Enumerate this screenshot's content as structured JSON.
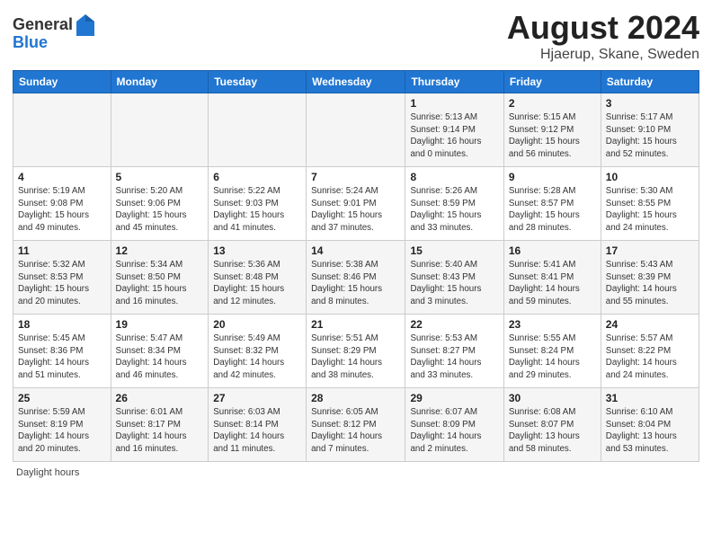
{
  "header": {
    "logo_general": "General",
    "logo_blue": "Blue",
    "main_title": "August 2024",
    "subtitle": "Hjaerup, Skane, Sweden"
  },
  "weekdays": [
    "Sunday",
    "Monday",
    "Tuesday",
    "Wednesday",
    "Thursday",
    "Friday",
    "Saturday"
  ],
  "footer": "Daylight hours",
  "weeks": [
    [
      {
        "day": "",
        "info": ""
      },
      {
        "day": "",
        "info": ""
      },
      {
        "day": "",
        "info": ""
      },
      {
        "day": "",
        "info": ""
      },
      {
        "day": "1",
        "info": "Sunrise: 5:13 AM\nSunset: 9:14 PM\nDaylight: 16 hours\nand 0 minutes."
      },
      {
        "day": "2",
        "info": "Sunrise: 5:15 AM\nSunset: 9:12 PM\nDaylight: 15 hours\nand 56 minutes."
      },
      {
        "day": "3",
        "info": "Sunrise: 5:17 AM\nSunset: 9:10 PM\nDaylight: 15 hours\nand 52 minutes."
      }
    ],
    [
      {
        "day": "4",
        "info": "Sunrise: 5:19 AM\nSunset: 9:08 PM\nDaylight: 15 hours\nand 49 minutes."
      },
      {
        "day": "5",
        "info": "Sunrise: 5:20 AM\nSunset: 9:06 PM\nDaylight: 15 hours\nand 45 minutes."
      },
      {
        "day": "6",
        "info": "Sunrise: 5:22 AM\nSunset: 9:03 PM\nDaylight: 15 hours\nand 41 minutes."
      },
      {
        "day": "7",
        "info": "Sunrise: 5:24 AM\nSunset: 9:01 PM\nDaylight: 15 hours\nand 37 minutes."
      },
      {
        "day": "8",
        "info": "Sunrise: 5:26 AM\nSunset: 8:59 PM\nDaylight: 15 hours\nand 33 minutes."
      },
      {
        "day": "9",
        "info": "Sunrise: 5:28 AM\nSunset: 8:57 PM\nDaylight: 15 hours\nand 28 minutes."
      },
      {
        "day": "10",
        "info": "Sunrise: 5:30 AM\nSunset: 8:55 PM\nDaylight: 15 hours\nand 24 minutes."
      }
    ],
    [
      {
        "day": "11",
        "info": "Sunrise: 5:32 AM\nSunset: 8:53 PM\nDaylight: 15 hours\nand 20 minutes."
      },
      {
        "day": "12",
        "info": "Sunrise: 5:34 AM\nSunset: 8:50 PM\nDaylight: 15 hours\nand 16 minutes."
      },
      {
        "day": "13",
        "info": "Sunrise: 5:36 AM\nSunset: 8:48 PM\nDaylight: 15 hours\nand 12 minutes."
      },
      {
        "day": "14",
        "info": "Sunrise: 5:38 AM\nSunset: 8:46 PM\nDaylight: 15 hours\nand 8 minutes."
      },
      {
        "day": "15",
        "info": "Sunrise: 5:40 AM\nSunset: 8:43 PM\nDaylight: 15 hours\nand 3 minutes."
      },
      {
        "day": "16",
        "info": "Sunrise: 5:41 AM\nSunset: 8:41 PM\nDaylight: 14 hours\nand 59 minutes."
      },
      {
        "day": "17",
        "info": "Sunrise: 5:43 AM\nSunset: 8:39 PM\nDaylight: 14 hours\nand 55 minutes."
      }
    ],
    [
      {
        "day": "18",
        "info": "Sunrise: 5:45 AM\nSunset: 8:36 PM\nDaylight: 14 hours\nand 51 minutes."
      },
      {
        "day": "19",
        "info": "Sunrise: 5:47 AM\nSunset: 8:34 PM\nDaylight: 14 hours\nand 46 minutes."
      },
      {
        "day": "20",
        "info": "Sunrise: 5:49 AM\nSunset: 8:32 PM\nDaylight: 14 hours\nand 42 minutes."
      },
      {
        "day": "21",
        "info": "Sunrise: 5:51 AM\nSunset: 8:29 PM\nDaylight: 14 hours\nand 38 minutes."
      },
      {
        "day": "22",
        "info": "Sunrise: 5:53 AM\nSunset: 8:27 PM\nDaylight: 14 hours\nand 33 minutes."
      },
      {
        "day": "23",
        "info": "Sunrise: 5:55 AM\nSunset: 8:24 PM\nDaylight: 14 hours\nand 29 minutes."
      },
      {
        "day": "24",
        "info": "Sunrise: 5:57 AM\nSunset: 8:22 PM\nDaylight: 14 hours\nand 24 minutes."
      }
    ],
    [
      {
        "day": "25",
        "info": "Sunrise: 5:59 AM\nSunset: 8:19 PM\nDaylight: 14 hours\nand 20 minutes."
      },
      {
        "day": "26",
        "info": "Sunrise: 6:01 AM\nSunset: 8:17 PM\nDaylight: 14 hours\nand 16 minutes."
      },
      {
        "day": "27",
        "info": "Sunrise: 6:03 AM\nSunset: 8:14 PM\nDaylight: 14 hours\nand 11 minutes."
      },
      {
        "day": "28",
        "info": "Sunrise: 6:05 AM\nSunset: 8:12 PM\nDaylight: 14 hours\nand 7 minutes."
      },
      {
        "day": "29",
        "info": "Sunrise: 6:07 AM\nSunset: 8:09 PM\nDaylight: 14 hours\nand 2 minutes."
      },
      {
        "day": "30",
        "info": "Sunrise: 6:08 AM\nSunset: 8:07 PM\nDaylight: 13 hours\nand 58 minutes."
      },
      {
        "day": "31",
        "info": "Sunrise: 6:10 AM\nSunset: 8:04 PM\nDaylight: 13 hours\nand 53 minutes."
      }
    ]
  ]
}
